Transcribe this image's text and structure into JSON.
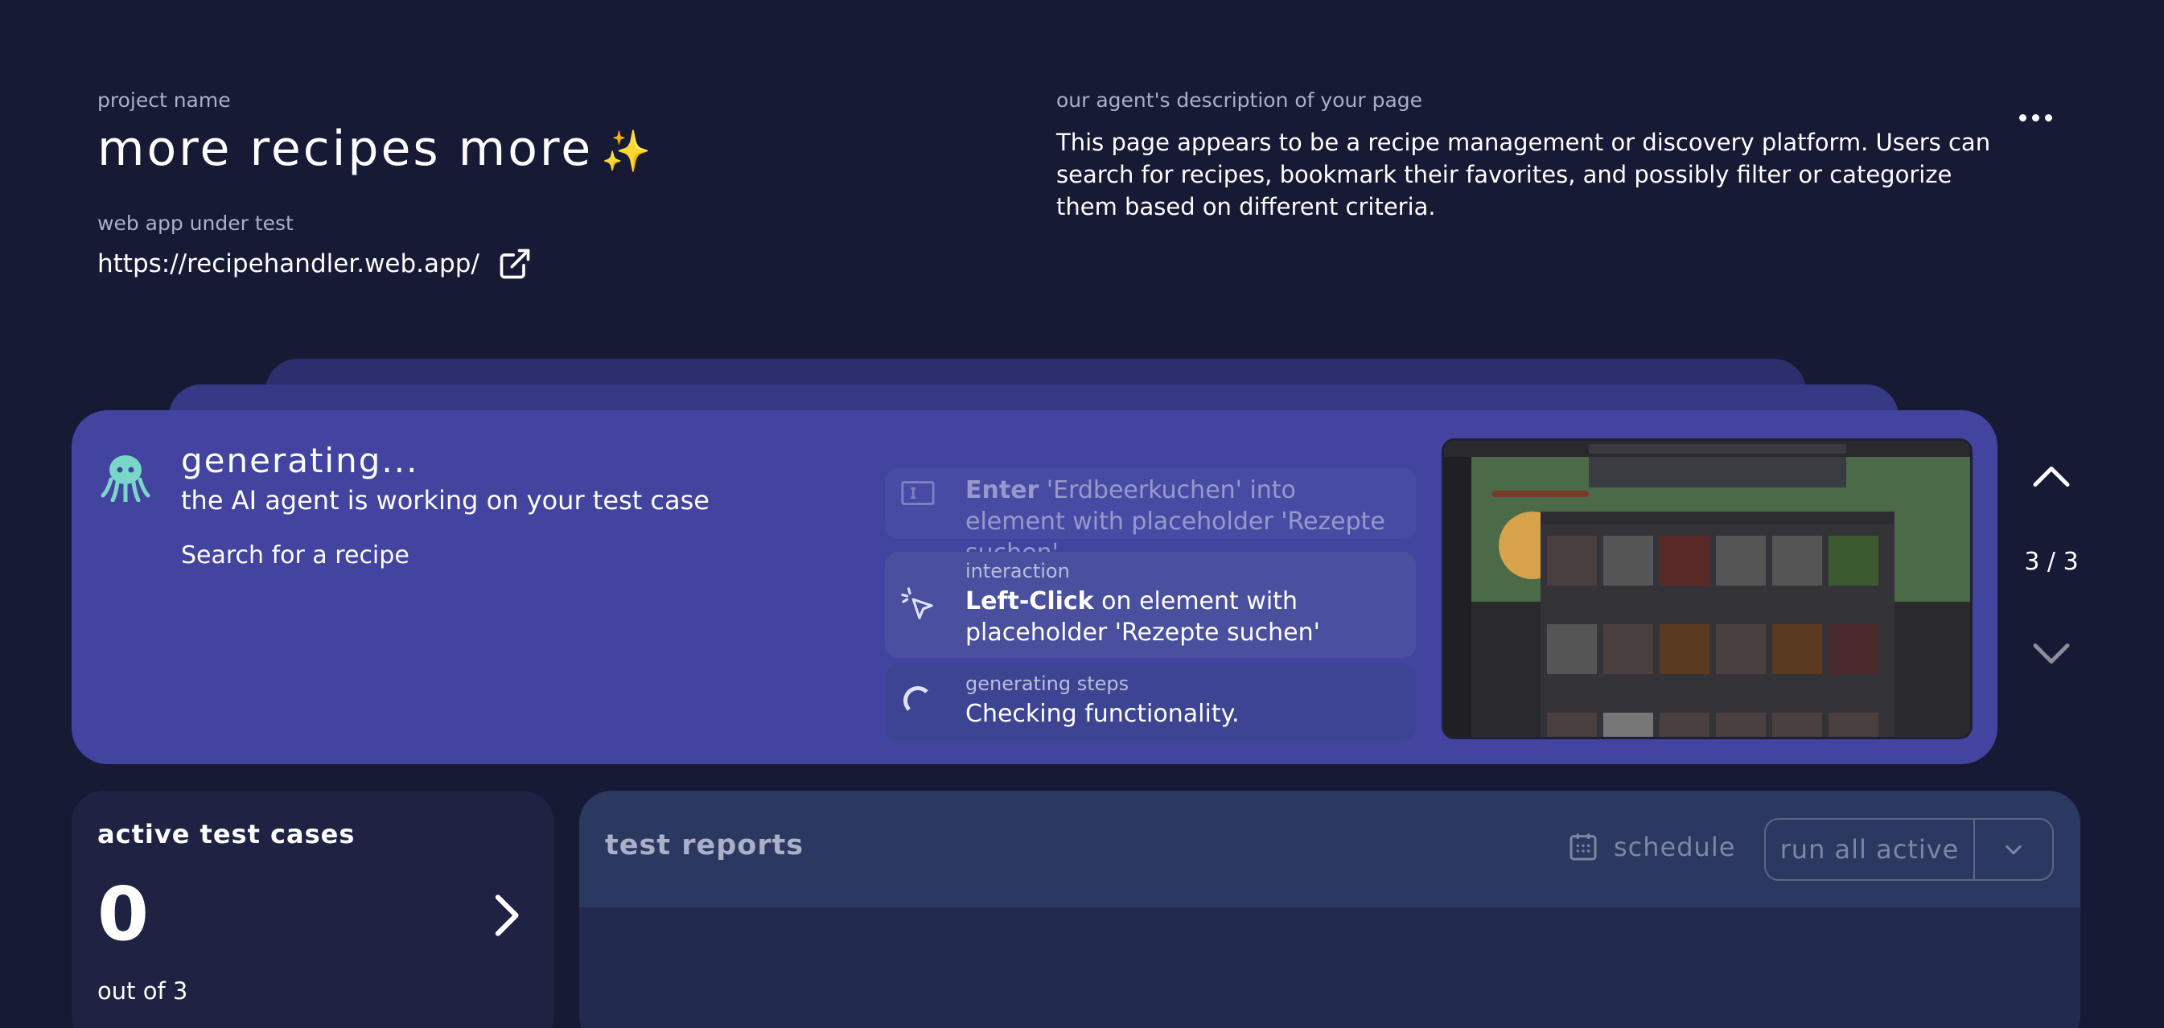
{
  "project": {
    "name_label": "project name",
    "name": "more recipes more",
    "name_emoji": "✨",
    "url_label": "web app under test",
    "url": "https://recipehandler.web.app/"
  },
  "description": {
    "label": "our agent's description of your page",
    "text": "This page appears to be a recipe management or discovery platform. Users can search for recipes, bookmark their favorites, and possibly filter or categorize them based on different criteria."
  },
  "generation": {
    "title": "generating...",
    "subtitle": "the AI agent is working on your test case",
    "test_case": "Search for a recipe",
    "steps": [
      {
        "action": "Enter",
        "text": " 'Erdbeerkuchen' into element with placeholder 'Rezepte suchen'"
      },
      {
        "label": "interaction",
        "action": "Left-Click",
        "text": " on element with placeholder 'Rezepte suchen'"
      },
      {
        "label": "generating steps",
        "text": "Checking functionality."
      }
    ],
    "counter": "3 / 3"
  },
  "active_cases": {
    "title": "active test cases",
    "count": "0",
    "out_of": "out of 3"
  },
  "reports": {
    "title": "test reports",
    "schedule_label": "schedule",
    "run_label": "run all active"
  },
  "colors": {
    "background": "#161a35",
    "card": "#4244a0",
    "accent": "#7ad7c8"
  }
}
